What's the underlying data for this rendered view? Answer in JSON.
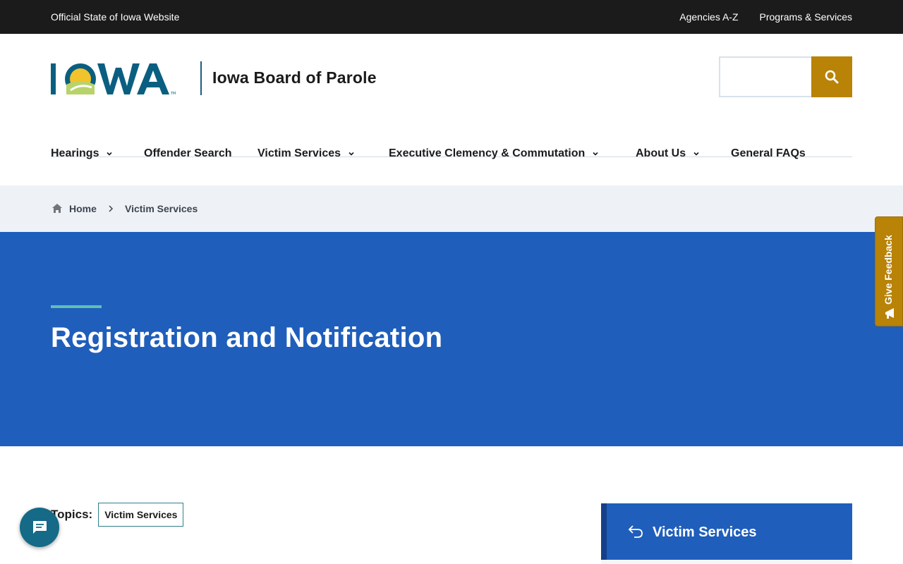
{
  "colors": {
    "topbar_bg": "#1b1b1b",
    "hero_bg": "#1f5ebb",
    "accent_gold": "#b88306",
    "accent_teal": "#5fbfb1",
    "breadcrumb_bg": "#eef2f6",
    "logo_blue": "#0a5f80"
  },
  "topbar": {
    "official": "Official State of Iowa Website",
    "links": [
      "Agencies A-Z",
      "Programs & Services"
    ]
  },
  "header": {
    "logo_text": "IOWA",
    "site_name": "Iowa Board of Parole",
    "search": {
      "value": "",
      "placeholder": "",
      "button_icon": "search-icon"
    }
  },
  "nav": {
    "items": [
      {
        "label": "Hearings",
        "has_dropdown": true
      },
      {
        "label": "Offender Search",
        "has_dropdown": false
      },
      {
        "label": "Victim Services",
        "has_dropdown": true
      },
      {
        "label": "Executive Clemency & Commutation",
        "has_dropdown": true
      },
      {
        "label": "About Us",
        "has_dropdown": true
      },
      {
        "label": "General FAQs",
        "has_dropdown": false
      }
    ]
  },
  "breadcrumb": {
    "home": "Home",
    "current": "Victim Services",
    "icons": [
      "home-icon",
      "chevron-right-icon"
    ]
  },
  "hero": {
    "title": "Registration and Notification"
  },
  "feedback": {
    "label": "Give Feedback",
    "icon": "megaphone-icon"
  },
  "topics": {
    "label": "Topics:",
    "tags": [
      "Victim Services"
    ]
  },
  "sidebar": {
    "title": "Victim Services",
    "icon": "back-arrow-icon"
  },
  "chat": {
    "icon": "chat-icon"
  }
}
